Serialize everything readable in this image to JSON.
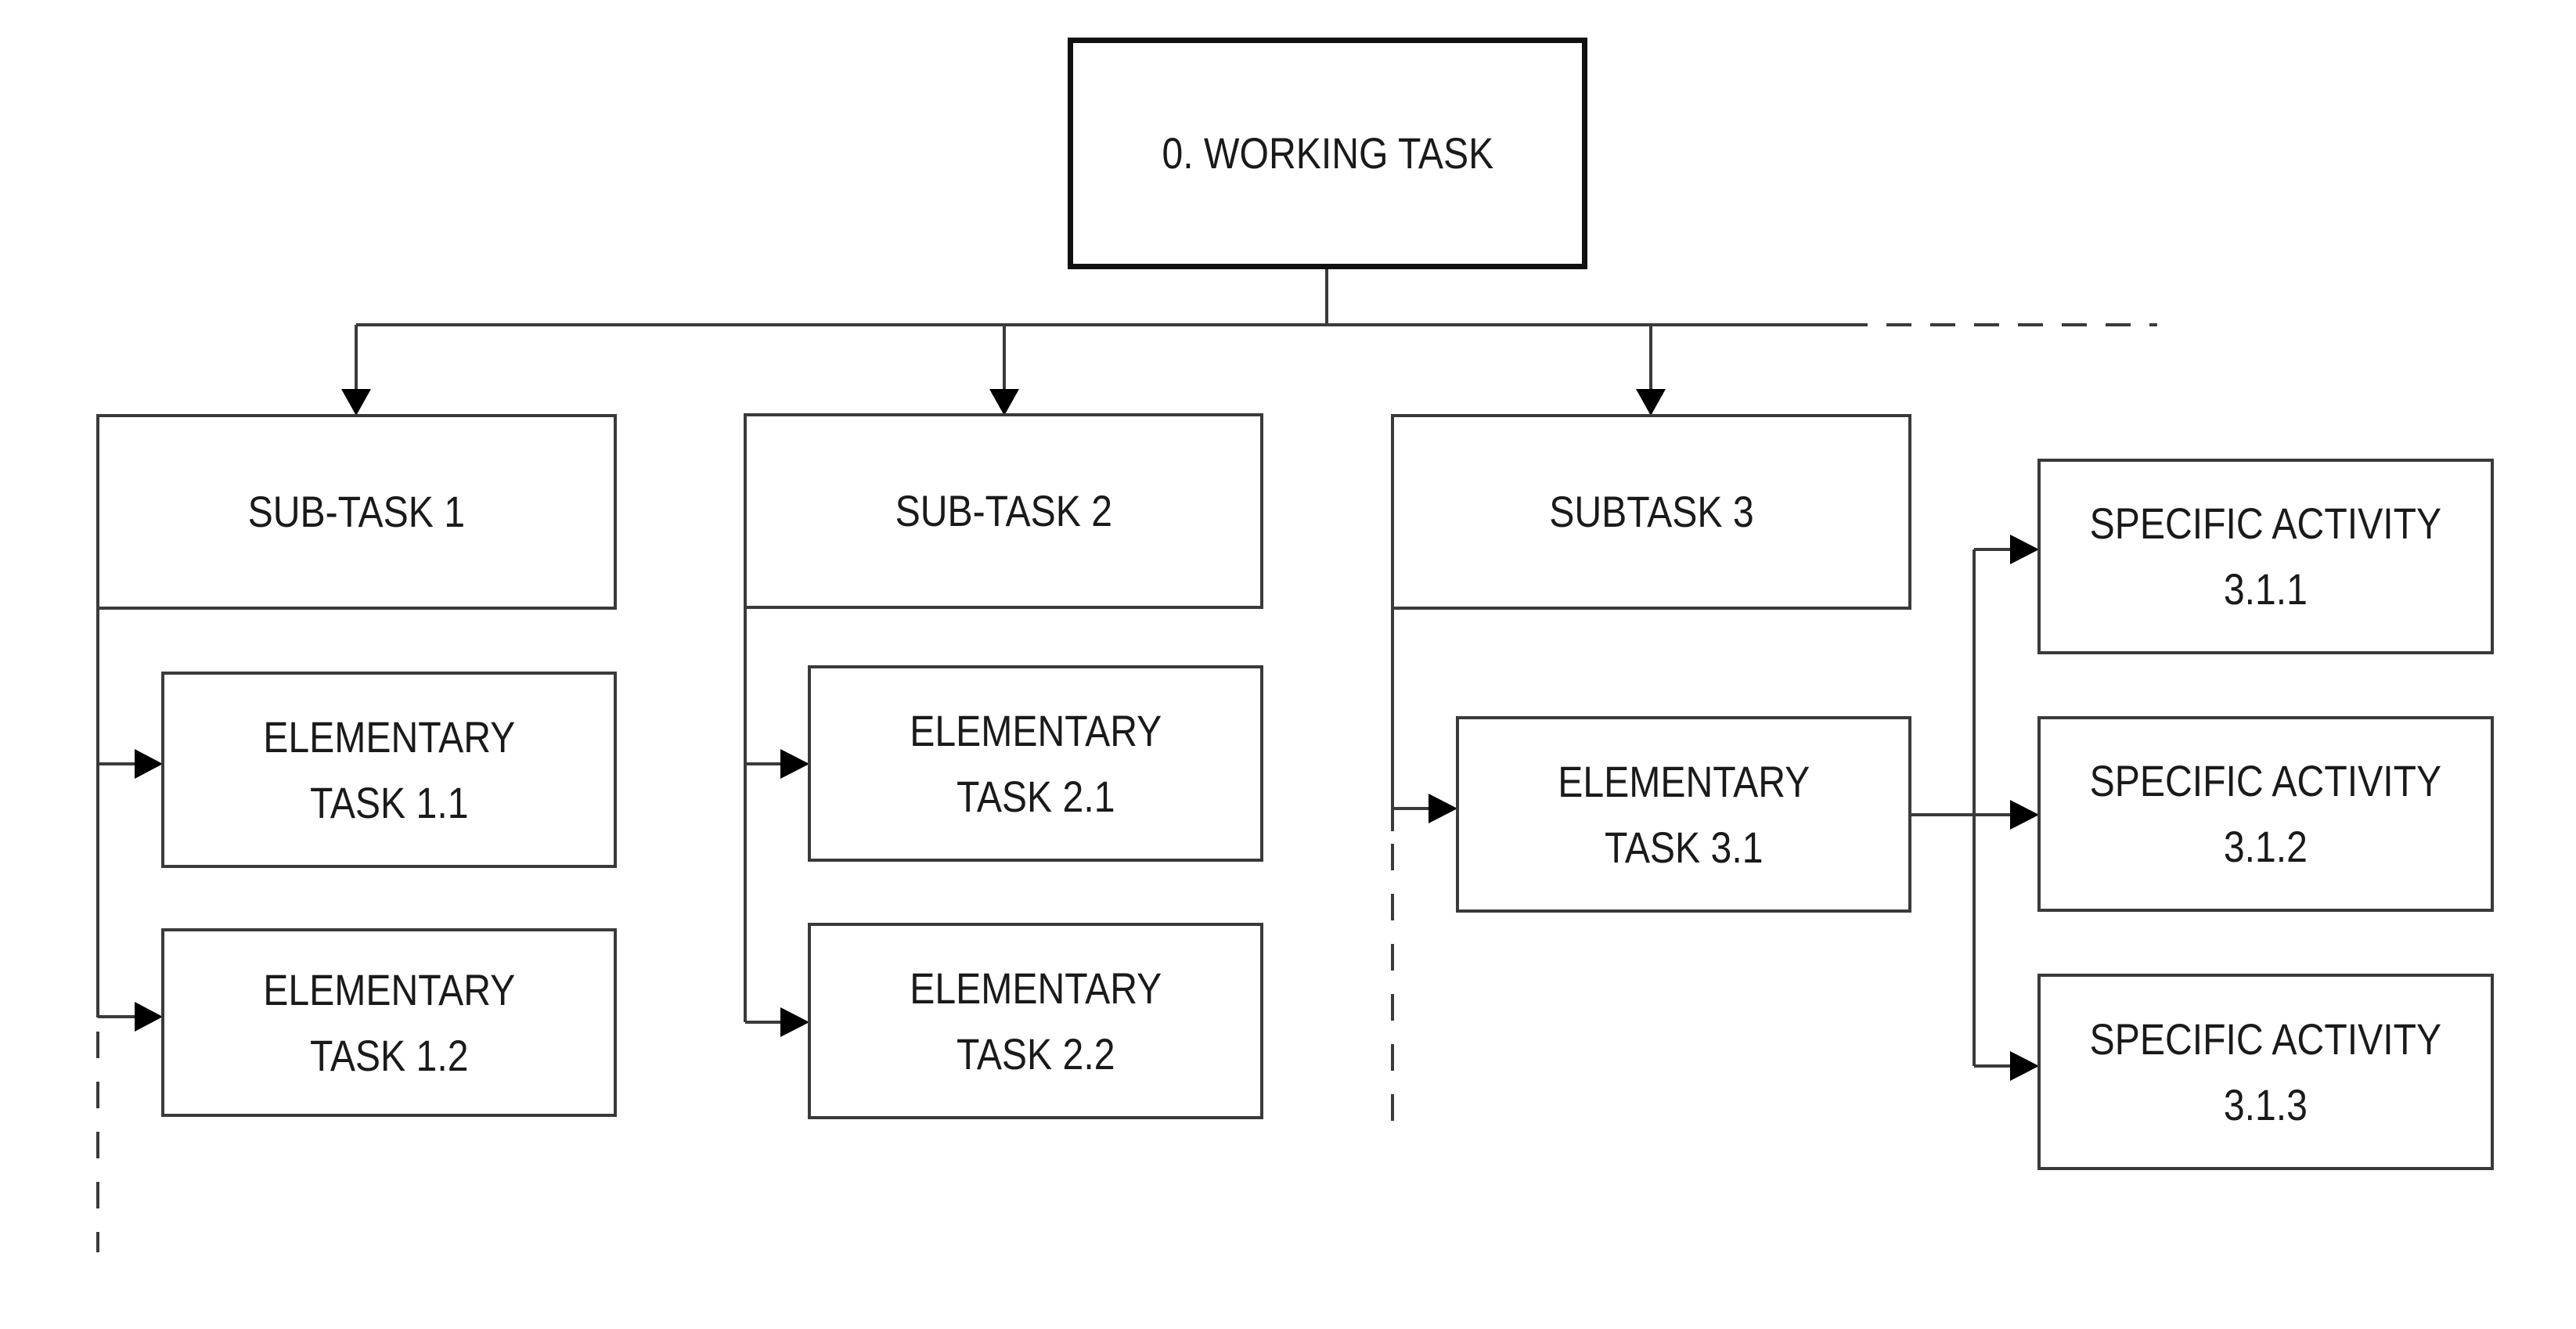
{
  "diagram": {
    "type": "task-decomposition-tree",
    "root": {
      "id": "root",
      "label": [
        "0. WORKING TASK"
      ]
    },
    "subtasks": [
      {
        "id": "st1",
        "label": [
          "SUB-TASK 1"
        ],
        "children": [
          {
            "id": "e11",
            "label": [
              "ELEMENTARY",
              "TASK 1.1"
            ]
          },
          {
            "id": "e12",
            "label": [
              "ELEMENTARY",
              "TASK 1.2"
            ]
          }
        ],
        "continues": true
      },
      {
        "id": "st2",
        "label": [
          "SUB-TASK 2"
        ],
        "children": [
          {
            "id": "e21",
            "label": [
              "ELEMENTARY",
              "TASK 2.1"
            ]
          },
          {
            "id": "e22",
            "label": [
              "ELEMENTARY",
              "TASK 2.2"
            ]
          }
        ],
        "continues": false
      },
      {
        "id": "st3",
        "label": [
          "SUBTASK 3"
        ],
        "children": [
          {
            "id": "e31",
            "label": [
              "ELEMENTARY",
              "TASK 3.1"
            ],
            "children": [
              {
                "id": "sa311",
                "label": [
                  "SPECIFIC ACTIVITY",
                  "3.1.1"
                ]
              },
              {
                "id": "sa312",
                "label": [
                  "SPECIFIC ACTIVITY",
                  "3.1.2"
                ]
              },
              {
                "id": "sa313",
                "label": [
                  "SPECIFIC ACTIVITY",
                  "3.1.3"
                ]
              }
            ]
          }
        ],
        "continues": true
      }
    ],
    "more_subtasks_indicated": true
  },
  "labels": {
    "root": "0. WORKING TASK",
    "st1": "SUB-TASK 1",
    "st2": "SUB-TASK 2",
    "st3": "SUBTASK 3",
    "e11": [
      "ELEMENTARY",
      "TASK 1.1"
    ],
    "e12": [
      "ELEMENTARY",
      "TASK 1.2"
    ],
    "e21": [
      "ELEMENTARY",
      "TASK 2.1"
    ],
    "e22": [
      "ELEMENTARY",
      "TASK 2.2"
    ],
    "e31": [
      "ELEMENTARY",
      "TASK 3.1"
    ],
    "sa311": [
      "SPECIFIC ACTIVITY",
      "3.1.1"
    ],
    "sa312": [
      "SPECIFIC ACTIVITY",
      "3.1.2"
    ],
    "sa313": [
      "SPECIFIC ACTIVITY",
      "3.1.3"
    ]
  },
  "colors": {
    "line": "#3a3a3a",
    "arrow": "#000000",
    "text": "#1a1a1a",
    "background": "#ffffff"
  }
}
